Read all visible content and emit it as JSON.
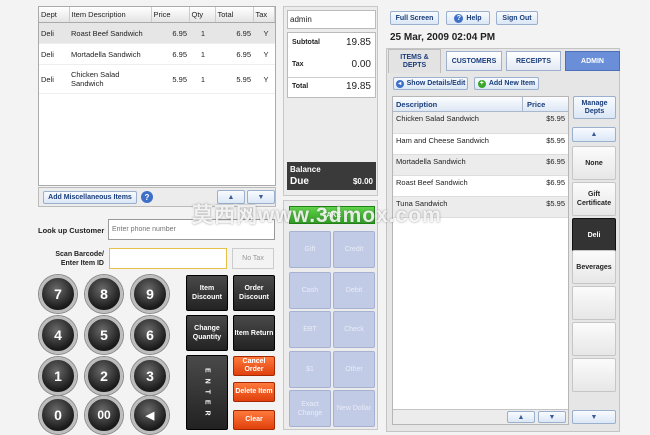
{
  "order": {
    "headers": [
      "Dept",
      "Item Description",
      "Price",
      "Qty",
      "Total",
      "Tax"
    ],
    "rows": [
      [
        "Deli",
        "Roast Beef Sandwich",
        "6.95",
        "1",
        "6.95",
        "Y"
      ],
      [
        "Deli",
        "Mortadella Sandwich",
        "6.95",
        "1",
        "6.95",
        "Y"
      ],
      [
        "Deli",
        "Chicken Salad Sandwich",
        "5.95",
        "1",
        "5.95",
        "Y"
      ]
    ],
    "misc_label": "Add Miscellaneous Items",
    "help_glyph": "?",
    "up": "▲",
    "down": "▼"
  },
  "lookup": {
    "label": "Look up Customer",
    "placeholder": "Enter phone number"
  },
  "scan": {
    "label1": "Scan Barcode/",
    "label2": "Enter Item ID",
    "no_tax": "No Tax"
  },
  "keypad": [
    "7",
    "8",
    "9",
    "4",
    "5",
    "6",
    "1",
    "2",
    "3",
    "0",
    "00",
    "◀"
  ],
  "dark_keys": [
    "Item Discount",
    "Order Discount",
    "Change Quantity",
    "Item Return"
  ],
  "enter_label": "E N T E R",
  "red_keys": [
    "Cancel Order",
    "Delete Item",
    "Clear"
  ],
  "totals": {
    "user": "admin",
    "subtotal_label": "Subtotal",
    "subtotal": "19.85",
    "tax_label": "Tax",
    "tax": "0.00",
    "total_label": "Total",
    "total": "19.85",
    "balance_label1": "Balance",
    "balance_label2": "Due",
    "balance": "$0.00"
  },
  "pay": {
    "green": "TAKE",
    "keys": [
      "Gift",
      "Credit",
      "Cash",
      "Debit",
      "EBT",
      "Check",
      "$1",
      "Other",
      "Exact Change",
      "New Dollar"
    ]
  },
  "top": {
    "full_screen": "Full Screen",
    "help": "Help",
    "sign_out": "Sign Out",
    "datetime": "25 Mar, 2009 02:04 PM"
  },
  "tabs": [
    "ITEMS & DEPTS",
    "CUSTOMERS",
    "RECEIPTS",
    "ADMIN"
  ],
  "actions": {
    "show_details": "Show Details/Edit",
    "add_item": "Add New Item"
  },
  "items": {
    "headers": [
      "Description",
      "Price"
    ],
    "rows": [
      [
        "Chicken Salad Sandwich",
        "$5.95"
      ],
      [
        "Ham and Cheese Sandwich",
        "$5.95"
      ],
      [
        "Mortadella Sandwich",
        "$6.95"
      ],
      [
        "Roast Beef Sandwich",
        "$6.95"
      ],
      [
        "Tuna Sandwich",
        "$5.95"
      ]
    ]
  },
  "categories": {
    "manage": "Manage Depts",
    "items": [
      "None",
      "Gift Certificate",
      "Deli",
      "Beverages"
    ]
  },
  "watermark": "莫西网www.3dmox.com",
  "colors": {
    "accent": "#6a8fd8",
    "red": "#e4501a",
    "green": "#3cb52d",
    "dark": "#2a2a2a"
  }
}
